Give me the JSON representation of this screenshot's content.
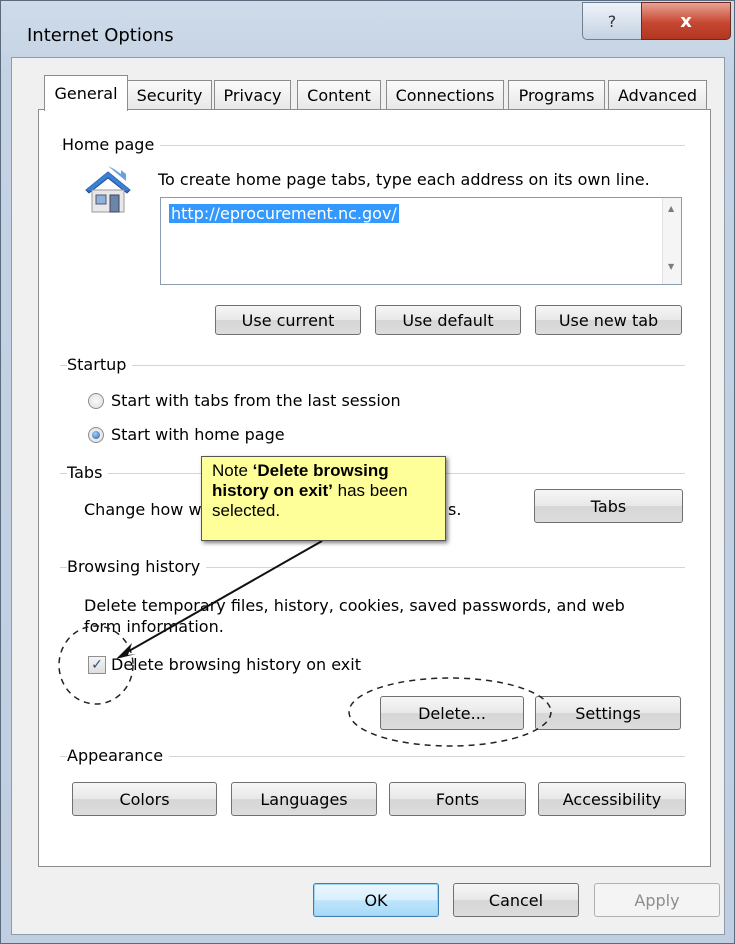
{
  "window": {
    "title": "Internet Options",
    "help_glyph": "?",
    "close_glyph": "x"
  },
  "tabs": [
    "General",
    "Security",
    "Privacy",
    "Content",
    "Connections",
    "Programs",
    "Advanced"
  ],
  "home_page": {
    "label": "Home page",
    "instruction": "To create home page tabs, type each address on its own line.",
    "address": "http://eprocurement.nc.gov/",
    "buttons": {
      "use_current": "Use current",
      "use_default": "Use default",
      "use_new_tab": "Use new tab"
    }
  },
  "startup": {
    "label": "Startup",
    "option_last_session": "Start with tabs from the last session",
    "option_home_page": "Start with home page",
    "selected": "Start with home page"
  },
  "tabs_group": {
    "label": "Tabs",
    "text_start": "Change how w",
    "text_end": "s.",
    "button": "Tabs"
  },
  "browsing_history": {
    "label": "Browsing history",
    "description_line1": "Delete temporary files, history, cookies, saved passwords, and web",
    "description_line2": "form information.",
    "checkbox_label": "Delete browsing history on exit",
    "checkbox_checked": true,
    "delete_button": "Delete...",
    "settings_button": "Settings"
  },
  "appearance": {
    "label": "Appearance",
    "buttons": {
      "colors": "Colors",
      "languages": "Languages",
      "fonts": "Fonts",
      "accessibility": "Accessibility"
    }
  },
  "note": {
    "prefix": "Note ",
    "bold": "‘Delete browsing history on exit’",
    "suffix": " has been selected."
  },
  "footer": {
    "ok": "OK",
    "cancel": "Cancel",
    "apply": "Apply"
  },
  "colors": {
    "selection": "#3399ff",
    "note_background": "#ffff99",
    "close_button": "#c64732"
  }
}
